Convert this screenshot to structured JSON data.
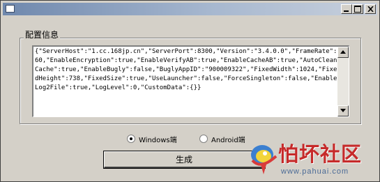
{
  "window": {
    "title": "",
    "buttons": {
      "minimize": "minimize-icon",
      "maximize": "maximize-icon",
      "close": "close-icon"
    }
  },
  "config_group": {
    "label": "配置信息",
    "text": "{\"ServerHost\":\"1.cc.168jp.cn\",\"ServerPort\":8300,\"Version\":\"3.4.0.0\",\"FrameRate\":60,\"EnableEncryption\":true,\"EnableVerifyAB\":true,\"EnableCacheAB\":true,\"AutoCleanCache\":true,\"EnableBugly\":false,\"BuglyAppID\":\"900009322\",\"FixedWidth\":1024,\"FixedHeight\":738,\"FixedSize\":true,\"UseLauncher\":false,\"ForceSingleton\":false,\"EnableLog2File\":true,\"LogLevel\":0,\"CustomData\":{}}"
  },
  "platform": {
    "options": [
      {
        "label": "Windows端",
        "checked": true
      },
      {
        "label": "Android端",
        "checked": false
      }
    ]
  },
  "actions": {
    "generate_label": "生成"
  },
  "watermark": {
    "text": "怕坏社区",
    "url": "www.pahuai.com"
  },
  "colors": {
    "face": "#d4d0c8",
    "titlebar_start": "#6f88ad",
    "watermark_red": "#c62a2a"
  }
}
